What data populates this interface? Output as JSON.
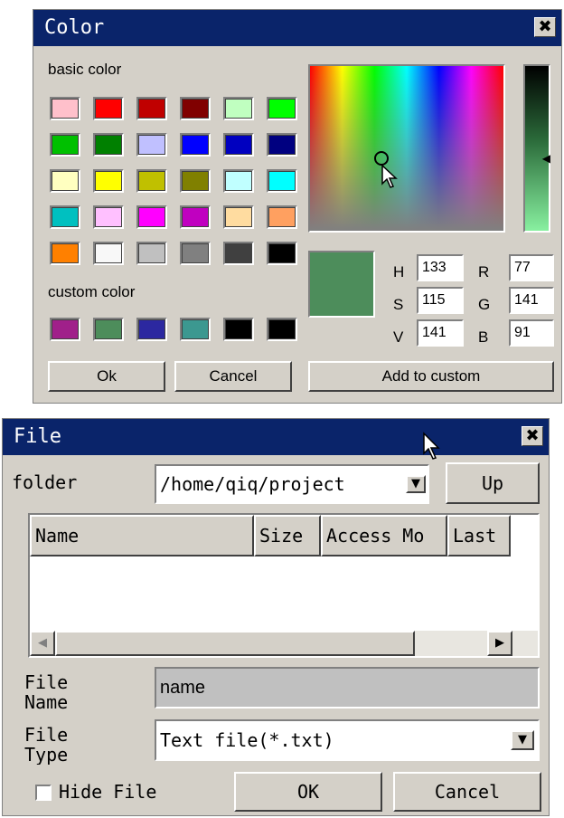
{
  "color_dialog": {
    "title": "Color",
    "close_glyph": "✖",
    "basic_label": "basic color",
    "custom_label": "custom color",
    "basic_colors": [
      "#ffc0cb",
      "#ff0000",
      "#c00000",
      "#800000",
      "#c0ffc0",
      "#00ff00",
      "#00c000",
      "#008000",
      "#c0c0ff",
      "#0000ff",
      "#0000c0",
      "#000080",
      "#ffffc0",
      "#ffff00",
      "#c0c000",
      "#808000",
      "#c0ffff",
      "#00ffff",
      "#00c0c0",
      "#ffc0ff",
      "#ff00ff",
      "#c000c0",
      "#ffdca0",
      "#ffa060",
      "#ff8000",
      "#f8f8f8",
      "#c0c0c0",
      "#808080",
      "#404040",
      "#000000"
    ],
    "custom_colors": [
      "#a0208a",
      "#4d8d5b",
      "#2c28a0",
      "#3c9890",
      "#000000",
      "#000000"
    ],
    "current_color": "#4d8d5b",
    "hsv": {
      "h_label": "H",
      "h_value": "133",
      "s_label": "S",
      "s_value": "115",
      "v_label": "V",
      "v_value": "141"
    },
    "rgb": {
      "r_label": "R",
      "r_value": "77",
      "g_label": "G",
      "g_value": "141",
      "b_label": "B",
      "b_value": "91"
    },
    "ok_label": "Ok",
    "cancel_label": "Cancel",
    "add_custom_label": "Add to custom"
  },
  "file_dialog": {
    "title": "File",
    "close_glyph": "✖",
    "folder_label": "folder",
    "folder_value": "/home/qiq/project",
    "up_label": "Up",
    "columns": [
      "Name",
      "Size",
      "Access Mo",
      "Last"
    ],
    "file_name_label": "File Name",
    "file_name_value": "name",
    "file_type_label": "File Type",
    "file_type_value": "Text file(*.txt)",
    "hide_file_label": "Hide File",
    "ok_label": "OK",
    "cancel_label": "Cancel"
  }
}
